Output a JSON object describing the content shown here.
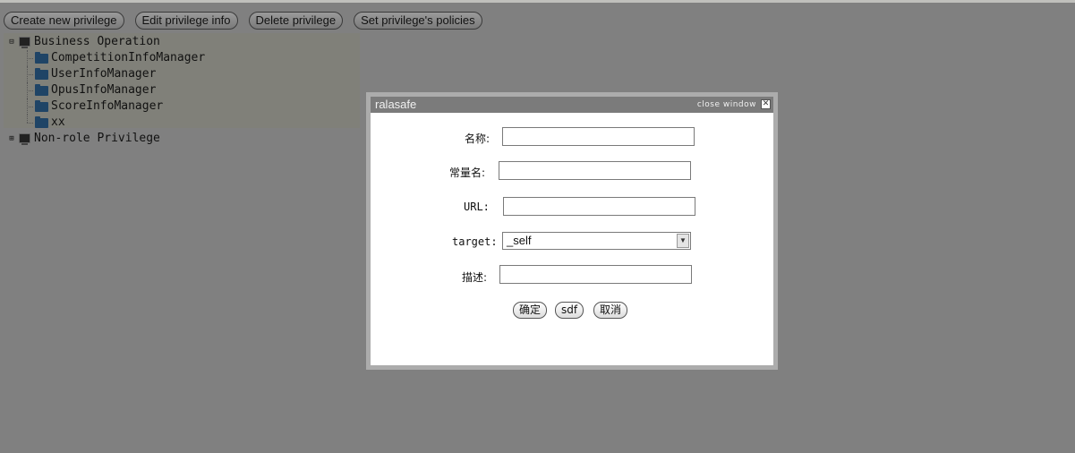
{
  "toolbar": {
    "create_label": "Create new privilege",
    "edit_label": "Edit privilege info",
    "delete_label": "Delete privilege",
    "policies_label": "Set privilege's policies"
  },
  "tree": {
    "root": {
      "label": "Business Operation",
      "icon": "computer-icon",
      "expanded": true
    },
    "children": [
      {
        "label": "CompetitionInfoManager",
        "icon": "folder-icon"
      },
      {
        "label": "UserInfoManager",
        "icon": "folder-icon"
      },
      {
        "label": "OpusInfoManager",
        "icon": "folder-icon"
      },
      {
        "label": "ScoreInfoManager",
        "icon": "folder-icon"
      },
      {
        "label": "xx",
        "icon": "folder-icon"
      }
    ],
    "second_root": {
      "label": "Non-role Privilege",
      "icon": "computer-icon",
      "expanded": false
    }
  },
  "dialog": {
    "title": "ralasafe",
    "close_label": "close window",
    "close_glyph": "✕",
    "fields": {
      "name_label": "名称:",
      "name_value": "",
      "constant_label": "常量名:",
      "constant_value": "",
      "url_label": "URL:",
      "url_value": "",
      "target_label": "target:",
      "target_value": "_self",
      "desc_label": "描述:",
      "desc_value": ""
    },
    "buttons": {
      "ok_label": "确定",
      "sdf_label": "sdf",
      "cancel_label": "取消"
    }
  },
  "colors": {
    "page_bg": "#808080",
    "dialog_title_bg": "#7b7b7b",
    "dialog_frame": "#acacac"
  }
}
